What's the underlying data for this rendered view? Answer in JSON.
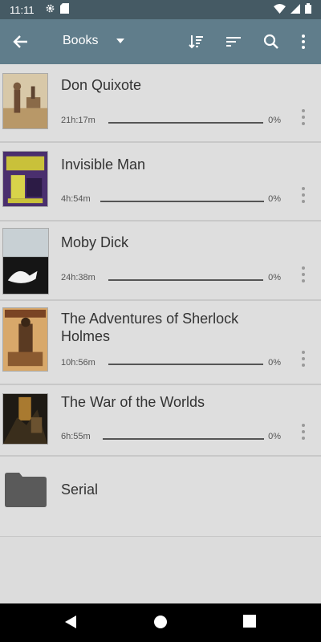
{
  "status_bar": {
    "time": "11:11"
  },
  "toolbar": {
    "title": "Books",
    "icons": [
      "back-arrow-icon",
      "sort-order-icon",
      "filter-icon",
      "search-icon",
      "more-vert-icon"
    ]
  },
  "books": [
    {
      "title": "Don Quixote",
      "duration": "21h:17m",
      "progress": "0%",
      "progress_value": 0
    },
    {
      "title": "Invisible Man",
      "duration": "4h:54m",
      "progress": "0%",
      "progress_value": 0
    },
    {
      "title": "Moby Dick",
      "duration": "24h:38m",
      "progress": "0%",
      "progress_value": 0
    },
    {
      "title": "The Adventures of Sherlock Holmes",
      "duration": "10h:56m",
      "progress": "0%",
      "progress_value": 0
    },
    {
      "title": "The War of the Worlds",
      "duration": "6h:55m",
      "progress": "0%",
      "progress_value": 0
    }
  ],
  "folder": {
    "name": "Serial",
    "icon": "folder-icon"
  },
  "nav_bar": {
    "icons": [
      "back-triangle-icon",
      "home-circle-icon",
      "recents-square-icon"
    ]
  },
  "colors": {
    "status_bar": "#455a64",
    "toolbar": "#607d8b",
    "list_background": "#dedede"
  }
}
